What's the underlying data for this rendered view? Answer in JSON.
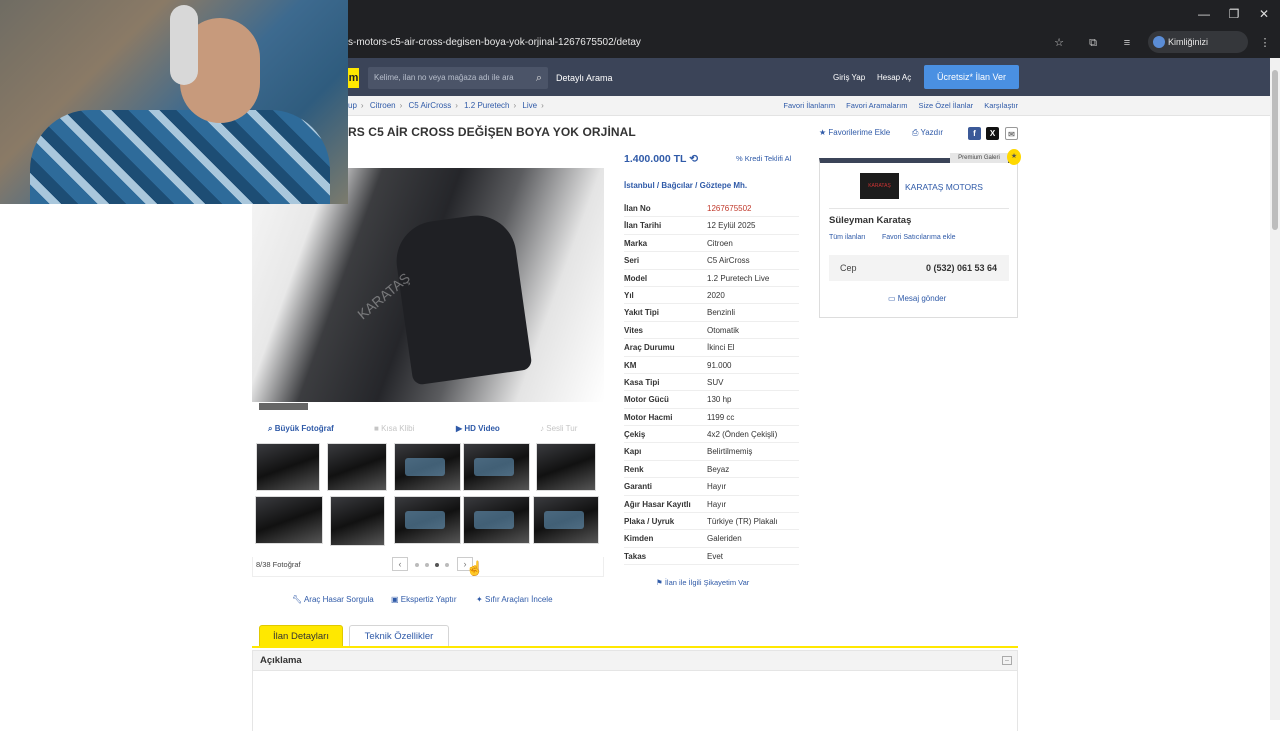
{
  "browser": {
    "url": "s-motors-c5-air-cross-degisen-boya-yok-orjinal-1267675502/detay",
    "identity": "Kimliğinizi doğrulayın",
    "window_buttons": [
      "—",
      "❐",
      "✕"
    ]
  },
  "header": {
    "logo": "m",
    "search_placeholder": "Kelime, ilan no veya mağaza adı ile ara",
    "detail_search": "Detaylı Arama",
    "login": "Giriş Yap",
    "register": "Hesap Aç",
    "cta": "Ücretsiz* İlan Ver"
  },
  "breadcrumb": [
    "up",
    "Citroen",
    "C5 AirCross",
    "1.2 Puretech",
    "Live"
  ],
  "right_links": [
    "Favori İlanlarım",
    "Favori Aramalarım",
    "Size Özel İlanlar",
    "Karşılaştır"
  ],
  "title": "RS C5 AİR CROSS DEĞİŞEN BOYA YOK ORJİNAL",
  "actions": {
    "favorite": "Favorilerime Ekle",
    "print": "Yazdır"
  },
  "price": "1.400.000 TL",
  "credit": "Kredi Teklifi Al",
  "location": {
    "city": "İstanbul",
    "district": "Bağcılar",
    "neighborhood": "Göztepe Mh."
  },
  "specs": [
    {
      "k": "İlan No",
      "v": "1267675502"
    },
    {
      "k": "İlan Tarihi",
      "v": "12 Eylül 2025"
    },
    {
      "k": "Marka",
      "v": "Citroen"
    },
    {
      "k": "Seri",
      "v": "C5 AirCross"
    },
    {
      "k": "Model",
      "v": "1.2 Puretech Live"
    },
    {
      "k": "Yıl",
      "v": "2020"
    },
    {
      "k": "Yakıt Tipi",
      "v": "Benzinli"
    },
    {
      "k": "Vites",
      "v": "Otomatik"
    },
    {
      "k": "Araç Durumu",
      "v": "İkinci El"
    },
    {
      "k": "KM",
      "v": "91.000"
    },
    {
      "k": "Kasa Tipi",
      "v": "SUV"
    },
    {
      "k": "Motor Gücü",
      "v": "130 hp"
    },
    {
      "k": "Motor Hacmi",
      "v": "1199 cc"
    },
    {
      "k": "Çekiş",
      "v": "4x2 (Önden Çekişli)"
    },
    {
      "k": "Kapı",
      "v": "Belirtilmemiş"
    },
    {
      "k": "Renk",
      "v": "Beyaz"
    },
    {
      "k": "Garanti",
      "v": "Hayır"
    },
    {
      "k": "Ağır Hasar Kayıtlı",
      "v": "Hayır"
    },
    {
      "k": "Plaka / Uyruk",
      "v": "Türkiye (TR) Plakalı"
    },
    {
      "k": "Kimden",
      "v": "Galeriden"
    },
    {
      "k": "Takas",
      "v": "Evet"
    }
  ],
  "complaint": "İlan ile İlgili Şikayetim Var",
  "photo_tools": {
    "big": "Büyük Fotoğraf",
    "clip": "Kısa Klibi",
    "hd": "HD Video",
    "sound": "Sesli Tur"
  },
  "photo_counter": "8/38 Fotoğraf",
  "tools": {
    "damage": "Araç Hasar Sorgula",
    "expert": "Ekspertiz Yaptır",
    "zero": "Sıfır Araçları İncele"
  },
  "seller": {
    "badge": "Premium Galeri",
    "store": "KARATAŞ MOTORS",
    "logo_text": "KARATAŞ",
    "person": "Süleyman Karataş",
    "all_ads": "Tüm ilanları",
    "fav_seller": "Favori Satıcılarıma ekle",
    "phone_label": "Cep",
    "phone": "0 (532) 061 53 64",
    "message": "Mesaj gönder"
  },
  "tabs": {
    "details": "İlan Detayları",
    "tech": "Teknik Özellikler"
  },
  "section": {
    "description": "Açıklama"
  }
}
